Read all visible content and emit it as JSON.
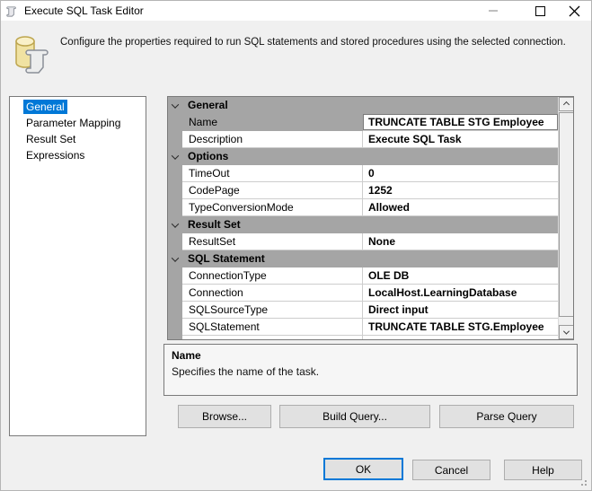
{
  "window": {
    "title": "Execute SQL Task Editor"
  },
  "header": {
    "description": "Configure the properties required to run SQL statements and stored procedures using the selected connection."
  },
  "icons": {
    "app_icon": "sql-task-scroll-icon",
    "header_icon": "database-scroll-icon",
    "minimize": "minimize-icon",
    "maximize": "maximize-icon",
    "close": "close-icon",
    "category_expand": "chevron-down-icon",
    "scroll_up": "chevron-up-icon",
    "scroll_down": "chevron-down-icon"
  },
  "sidebar": {
    "items": [
      {
        "label": "General",
        "selected": true
      },
      {
        "label": "Parameter Mapping",
        "selected": false
      },
      {
        "label": "Result Set",
        "selected": false
      },
      {
        "label": "Expressions",
        "selected": false
      }
    ]
  },
  "property_grid": {
    "rows": [
      {
        "type": "category",
        "label": "General"
      },
      {
        "type": "property",
        "label": "Name",
        "value": "TRUNCATE TABLE STG Employee",
        "selected": true
      },
      {
        "type": "property",
        "label": "Description",
        "value": "Execute SQL Task",
        "selected": false
      },
      {
        "type": "category",
        "label": "Options"
      },
      {
        "type": "property",
        "label": "TimeOut",
        "value": "0",
        "selected": false
      },
      {
        "type": "property",
        "label": "CodePage",
        "value": "1252",
        "selected": false
      },
      {
        "type": "property",
        "label": "TypeConversionMode",
        "value": "Allowed",
        "selected": false
      },
      {
        "type": "category",
        "label": "Result Set"
      },
      {
        "type": "property",
        "label": "ResultSet",
        "value": "None",
        "selected": false
      },
      {
        "type": "category",
        "label": "SQL Statement"
      },
      {
        "type": "property",
        "label": "ConnectionType",
        "value": "OLE DB",
        "selected": false
      },
      {
        "type": "property",
        "label": "Connection",
        "value": "LocalHost.LearningDatabase",
        "selected": false
      },
      {
        "type": "property",
        "label": "SQLSourceType",
        "value": "Direct input",
        "selected": false
      },
      {
        "type": "property",
        "label": "SQLStatement",
        "value": "TRUNCATE TABLE STG.Employee",
        "selected": false
      }
    ]
  },
  "help_panel": {
    "title": "Name",
    "description": "Specifies the name of the task."
  },
  "query_buttons": [
    {
      "label": "Browse..."
    },
    {
      "label": "Build Query..."
    },
    {
      "label": "Parse Query"
    }
  ],
  "dialog_buttons": [
    {
      "label": "OK",
      "focused": true
    },
    {
      "label": "Cancel",
      "focused": false
    },
    {
      "label": "Help",
      "focused": false
    }
  ],
  "colors": {
    "accent": "#0078d7",
    "selection_bg": "#0078d7",
    "category_bg": "#a5a5a5",
    "titlebar_bg": "#ffffff",
    "dialog_bg": "#f0f0f0",
    "button_bg": "#e1e1e1",
    "button_border": "#adadad",
    "panel_border": "#7a7a7a"
  }
}
